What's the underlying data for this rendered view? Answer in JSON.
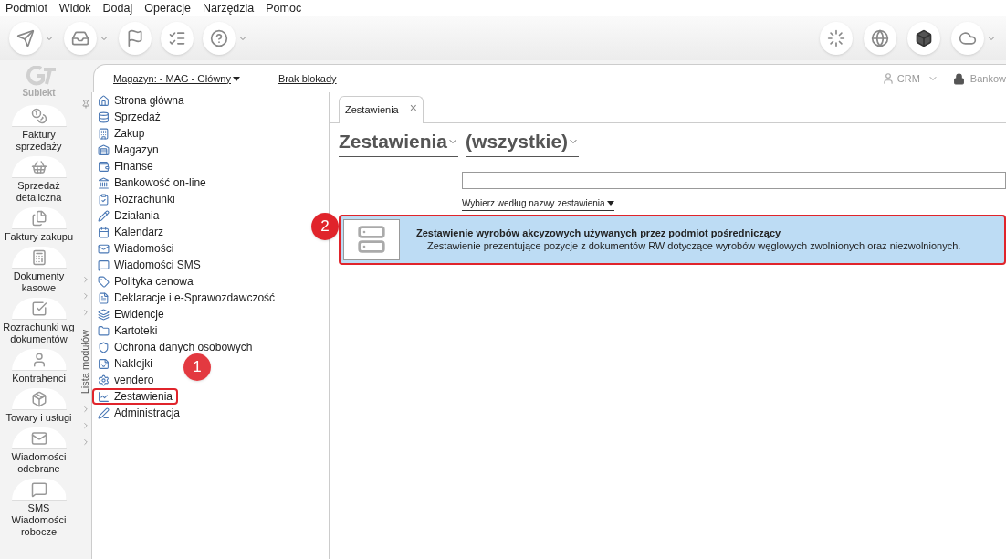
{
  "menu": [
    "Podmiot",
    "Widok",
    "Dodaj",
    "Operacje",
    "Narzędzia",
    "Pomoc"
  ],
  "logo": {
    "text": "Subiekt"
  },
  "nav": [
    {
      "label": "Faktury sprzedaży",
      "kind": "coins"
    },
    {
      "label": "Sprzedaż detaliczna",
      "kind": "basket"
    },
    {
      "label": "Faktury zakupu",
      "kind": "docs"
    },
    {
      "label": "Dokumenty kasowe",
      "kind": "register"
    },
    {
      "label": "Rozrachunki wg dokumentów",
      "kind": "check"
    },
    {
      "label": "Kontrahenci",
      "kind": "person"
    },
    {
      "label": "Towary i usługi",
      "kind": "box"
    },
    {
      "label": "Wiadomości odebrane",
      "kind": "mail"
    },
    {
      "label": "SMS Wiadomości robocze",
      "kind": "sms"
    }
  ],
  "header": {
    "warehouse": "Magazyn: - MAG - Główny",
    "lock": "Brak blokady",
    "crm": "CRM",
    "bank": "Bankow"
  },
  "module_strip": {
    "label": "Lista modułów"
  },
  "modules": [
    {
      "label": "Strona główna",
      "highlighted": false
    },
    {
      "label": "Sprzedaż",
      "highlighted": false
    },
    {
      "label": "Zakup",
      "highlighted": false
    },
    {
      "label": "Magazyn",
      "highlighted": false
    },
    {
      "label": "Finanse",
      "highlighted": false
    },
    {
      "label": "Bankowość on-line",
      "highlighted": false
    },
    {
      "label": "Rozrachunki",
      "highlighted": false
    },
    {
      "label": "Działania",
      "highlighted": false
    },
    {
      "label": "Kalendarz",
      "highlighted": false
    },
    {
      "label": "Wiadomości",
      "highlighted": false
    },
    {
      "label": "Wiadomości SMS",
      "highlighted": false
    },
    {
      "label": "Polityka cenowa",
      "highlighted": false
    },
    {
      "label": "Deklaracje i e-Sprawozdawczość",
      "highlighted": false
    },
    {
      "label": "Ewidencje",
      "highlighted": false
    },
    {
      "label": "Kartoteki",
      "highlighted": false
    },
    {
      "label": "Ochrona danych osobowych",
      "highlighted": false
    },
    {
      "label": "Naklejki",
      "highlighted": false
    },
    {
      "label": "vendero",
      "highlighted": false
    },
    {
      "label": "Zestawienia",
      "highlighted": true
    },
    {
      "label": "Administracja",
      "highlighted": false
    }
  ],
  "tabs": [
    {
      "label": "Zestawienia",
      "selected": true,
      "close": "×"
    }
  ],
  "filters": {
    "category": "Zestawienia",
    "group": "(wszystkie)",
    "search_hint": "Wybierz według nazwy zestawienia"
  },
  "results": [
    {
      "title": "Zestawienie wyrobów akcyzowych używanych przez podmiot pośredniczący",
      "description": "Zestawienie prezentujące pozycje z dokumentów RW dotyczące wyrobów węglowych zwolnionych oraz niezwolnionych.",
      "selected": true,
      "highlighted": true
    }
  ],
  "callouts": [
    "1",
    "2"
  ]
}
